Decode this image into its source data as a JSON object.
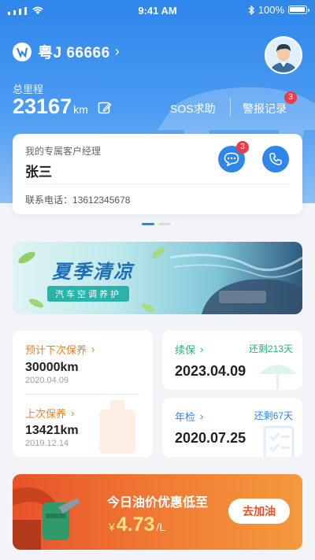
{
  "status": {
    "time": "9:41 AM",
    "battery": "100%"
  },
  "vehicle": {
    "plate": "粤J 66666"
  },
  "mileage": {
    "label": "总里程",
    "value": "23167",
    "unit": "km"
  },
  "actions": {
    "sos": "SOS求助",
    "alarm": "警报记录",
    "alarm_badge": "3"
  },
  "manager": {
    "title": "我的专属客户经理",
    "name": "张三",
    "phone_label": "联系电话：",
    "phone": "13612345678",
    "chat_badge": "3"
  },
  "banner": {
    "title": "夏季清凉",
    "subtitle": "汽车空调养护"
  },
  "maintenance": {
    "next_label": "预计下次保养",
    "next_value": "30000km",
    "next_date": "2020.04.09",
    "last_label": "上次保养",
    "last_value": "13421km",
    "last_date": "2019.12.14"
  },
  "insurance": {
    "label": "续保",
    "remaining": "还剩213天",
    "date": "2023.04.09"
  },
  "inspection": {
    "label": "年检",
    "remaining": "还剩67天",
    "date": "2020.07.25"
  },
  "oil": {
    "title": "今日油价优惠低至",
    "currency": "¥",
    "price": "4.73",
    "unit": "/L",
    "button": "去加油"
  },
  "colors": {
    "primary": "#2f86ea",
    "orange": "#e8822a",
    "green": "#2bb673",
    "blue_link": "#2f86ea",
    "badge": "#ef3a48"
  },
  "icons": [
    "signal-icon",
    "wifi-icon",
    "bluetooth-icon",
    "battery-icon",
    "brand-logo-icon",
    "chevron-right-icon",
    "avatar-icon",
    "edit-icon",
    "chat-icon",
    "phone-icon",
    "umbrella-icon",
    "checklist-icon",
    "oil-can-icon",
    "fuel-nozzle-icon"
  ]
}
